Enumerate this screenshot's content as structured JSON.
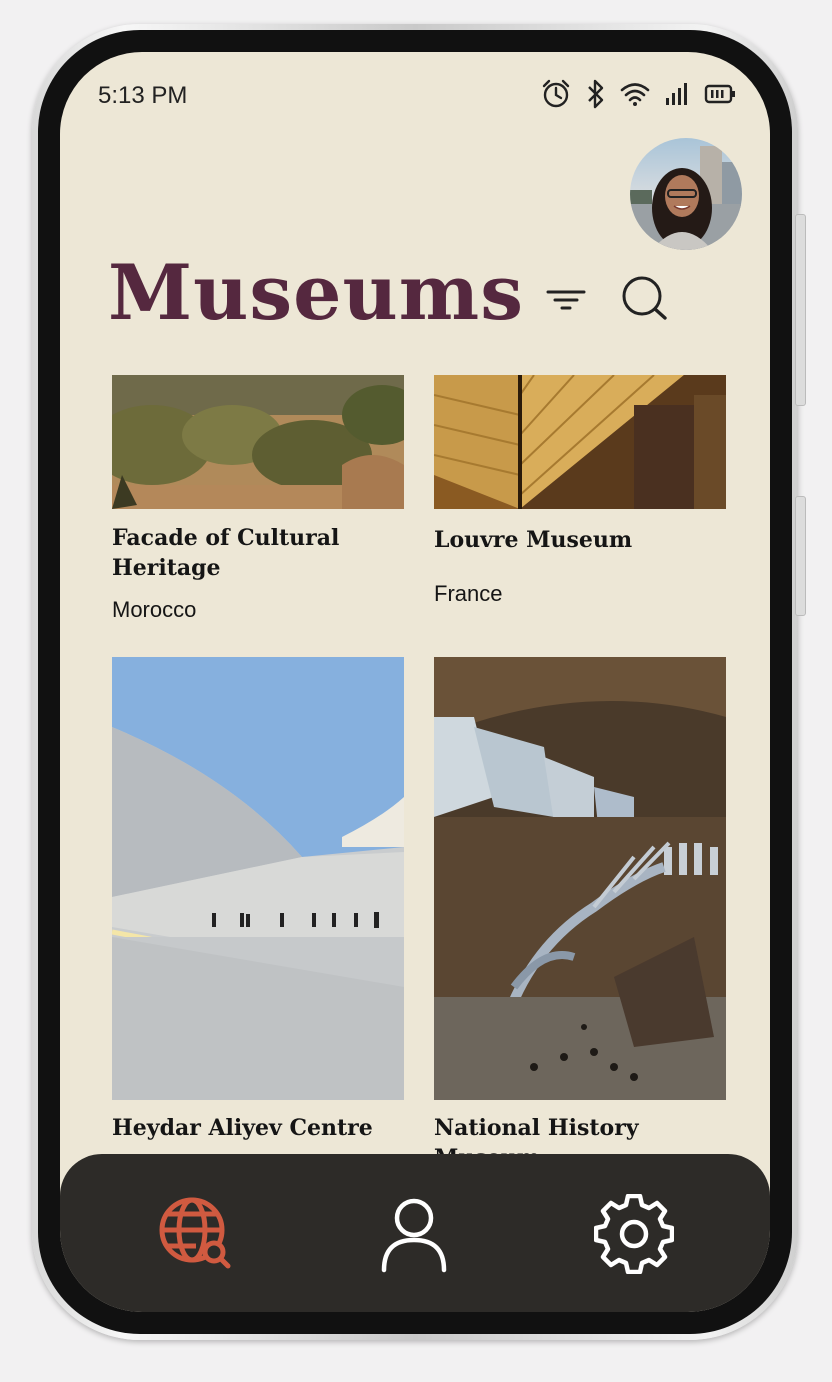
{
  "status_bar": {
    "time": "5:13 PM"
  },
  "header": {
    "title": "Museums"
  },
  "museums": [
    {
      "name": "Facade of Cultural Heritage",
      "country": "Morocco"
    },
    {
      "name": "Louvre Museum",
      "country": "France"
    },
    {
      "name": "Heydar Aliyev Centre",
      "country": ""
    },
    {
      "name": "National History Museum",
      "country": ""
    }
  ],
  "nav": {
    "items": [
      {
        "icon": "globe-search-icon",
        "active": true
      },
      {
        "icon": "user-icon",
        "active": false
      },
      {
        "icon": "gear-icon",
        "active": false
      }
    ],
    "active_color": "#d05a40",
    "inactive_color": "#ffffff"
  },
  "colors": {
    "title": "#55283f",
    "background": "#ede7d6",
    "nav_bg": "#2d2b28"
  }
}
